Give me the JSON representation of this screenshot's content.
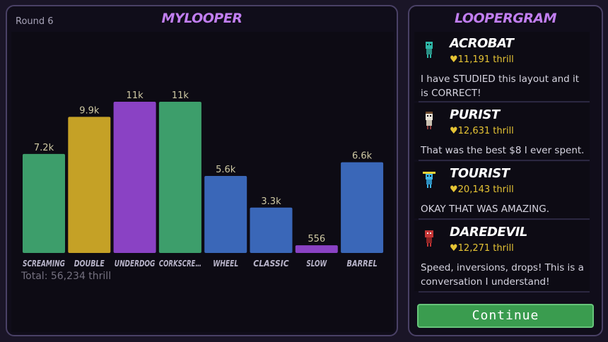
{
  "main": {
    "title": "MYLOOPER",
    "round_label": "Round 6",
    "total_label": "Total: 56,234 thrill"
  },
  "chart_data": {
    "type": "bar",
    "categories": [
      "SCREAMING",
      "DOUBLE",
      "UNDERDOG",
      "CORKSCRE…",
      "WHEEL",
      "CLASSIC",
      "SLOW",
      "BARREL"
    ],
    "values": [
      7200,
      9900,
      11000,
      11000,
      5600,
      3300,
      556,
      6600
    ],
    "value_labels": [
      "7.2k",
      "9.9k",
      "11k",
      "11k",
      "5.6k",
      "3.3k",
      "556",
      "6.6k"
    ],
    "colors": [
      "#3d9e6b",
      "#c5a126",
      "#8a42c4",
      "#3d9e6b",
      "#3a67b8",
      "#3a67b8",
      "#8a42c4",
      "#3a67b8"
    ],
    "ylim": [
      0,
      11000
    ],
    "title": "",
    "xlabel": "",
    "ylabel": ""
  },
  "side": {
    "title": "LOOPERGRAM",
    "posts": [
      {
        "name": "ACROBAT",
        "thrill": "♥11,191 thrill",
        "text": "I have STUDIED this layout and it is CORRECT!",
        "avatar": "acrobat-avatar-icon",
        "color": "#2fb7a8"
      },
      {
        "name": "PURIST",
        "thrill": "♥12,631 thrill",
        "text": "That was the best $8 I ever spent.",
        "avatar": "purist-avatar-icon",
        "color": "#e8e3d8"
      },
      {
        "name": "TOURIST",
        "thrill": "♥20,143 thrill",
        "text": "OKAY THAT WAS AMAZING.",
        "avatar": "tourist-avatar-icon",
        "color": "#3fb6e8"
      },
      {
        "name": "DAREDEVIL",
        "thrill": "♥12,271 thrill",
        "text": "Speed, inversions, drops! This is a conversation I understand!",
        "avatar": "daredevil-avatar-icon",
        "color": "#c43636"
      }
    ],
    "continue_label": "Continue"
  }
}
